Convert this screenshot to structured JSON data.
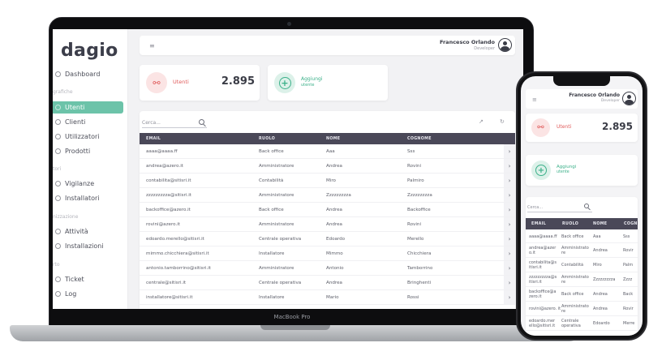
{
  "brand": {
    "logo": "dagio",
    "accent": "#6cc3a9",
    "danger": "#e05a5a"
  },
  "device_label": "MacBook Pro",
  "user": {
    "name": "Francesco Orlando",
    "role": "Developer"
  },
  "sidebar": {
    "items": [
      {
        "label": "Dashboard",
        "section": ""
      },
      {
        "label": "Utenti",
        "section": "grafiche",
        "active": true
      },
      {
        "label": "Clienti"
      },
      {
        "label": "Utilizzatori"
      },
      {
        "label": "Prodotti"
      },
      {
        "label": "Vigilanze",
        "section": "tori"
      },
      {
        "label": "Installatori"
      },
      {
        "label": "Attività",
        "section": "nizzazione"
      },
      {
        "label": "Installazioni"
      },
      {
        "label": "Ticket",
        "section": "rto"
      },
      {
        "label": "Log"
      }
    ]
  },
  "stats": {
    "users_label": "Utenti",
    "users_count": "2.895",
    "add_label": "Aggiungi",
    "add_sub": "utente"
  },
  "search": {
    "placeholder": "Cerca..."
  },
  "table": {
    "columns": [
      "EMAIL",
      "RUOLO",
      "NOME",
      "COGNOME"
    ],
    "rows": [
      [
        "aaaa@aaaa.ff",
        "Back office",
        "Aaa",
        "Sss"
      ],
      [
        "andrea@azero.it",
        "Amministratore",
        "Andrea",
        "Rovini"
      ],
      [
        "contabilita@sitisri.it",
        "Contabilità",
        "Miro",
        "Palmiro"
      ],
      [
        "zzzzzzzzza@sitisri.it",
        "Amministratore",
        "Zzzzzzzzza",
        "Zzzzzzzzza"
      ],
      [
        "backoffice@azero.it",
        "Back office",
        "Andrea",
        "Backoffice"
      ],
      [
        "rovini@azero.it",
        "Amministratore",
        "Andrea",
        "Rovini"
      ],
      [
        "edoardo.merello@sitisri.it",
        "Centrale operativa",
        "Edoardo",
        "Merello"
      ],
      [
        "mimmo.chicchiera@sitisri.it",
        "Installatore",
        "Mimmo",
        "Chicchiera"
      ],
      [
        "antonio.tamborrino@sitisri.it",
        "Amministratore",
        "Antonio",
        "Tamborrino"
      ],
      [
        "centrale@sitisri.it",
        "Centrale operativa",
        "Andrea",
        "Bringhenti"
      ],
      [
        "installatore@sitisri.it",
        "Installatore",
        "Mario",
        "Rossi"
      ]
    ]
  },
  "phone": {
    "columns": [
      "EMAIL",
      "RUOLO",
      "NOME",
      "COGN"
    ],
    "rows": [
      [
        "aaaa@aaaa.ff",
        "Back office",
        "Aaa",
        "Sss"
      ],
      [
        "andrea@azer o.it",
        "Amministrato re",
        "Andrea",
        "Rovir"
      ],
      [
        "contabilita@s itisri.it",
        "Contabilità",
        "Miro",
        "Palm"
      ],
      [
        "zzzzzzzzza@s itisri.it",
        "Amministrato re",
        "Zzzzzzzzza",
        "Zzzz"
      ],
      [
        "backoffice@a zero.it",
        "Back office",
        "Andrea",
        "Back"
      ],
      [
        "rovini@azero. it",
        "Amministrato re",
        "Andrea",
        "Rovir"
      ],
      [
        "edoardo.mer ello@sitisri.it",
        "Centrale operativa",
        "Edoardo",
        "Merre"
      ]
    ]
  }
}
